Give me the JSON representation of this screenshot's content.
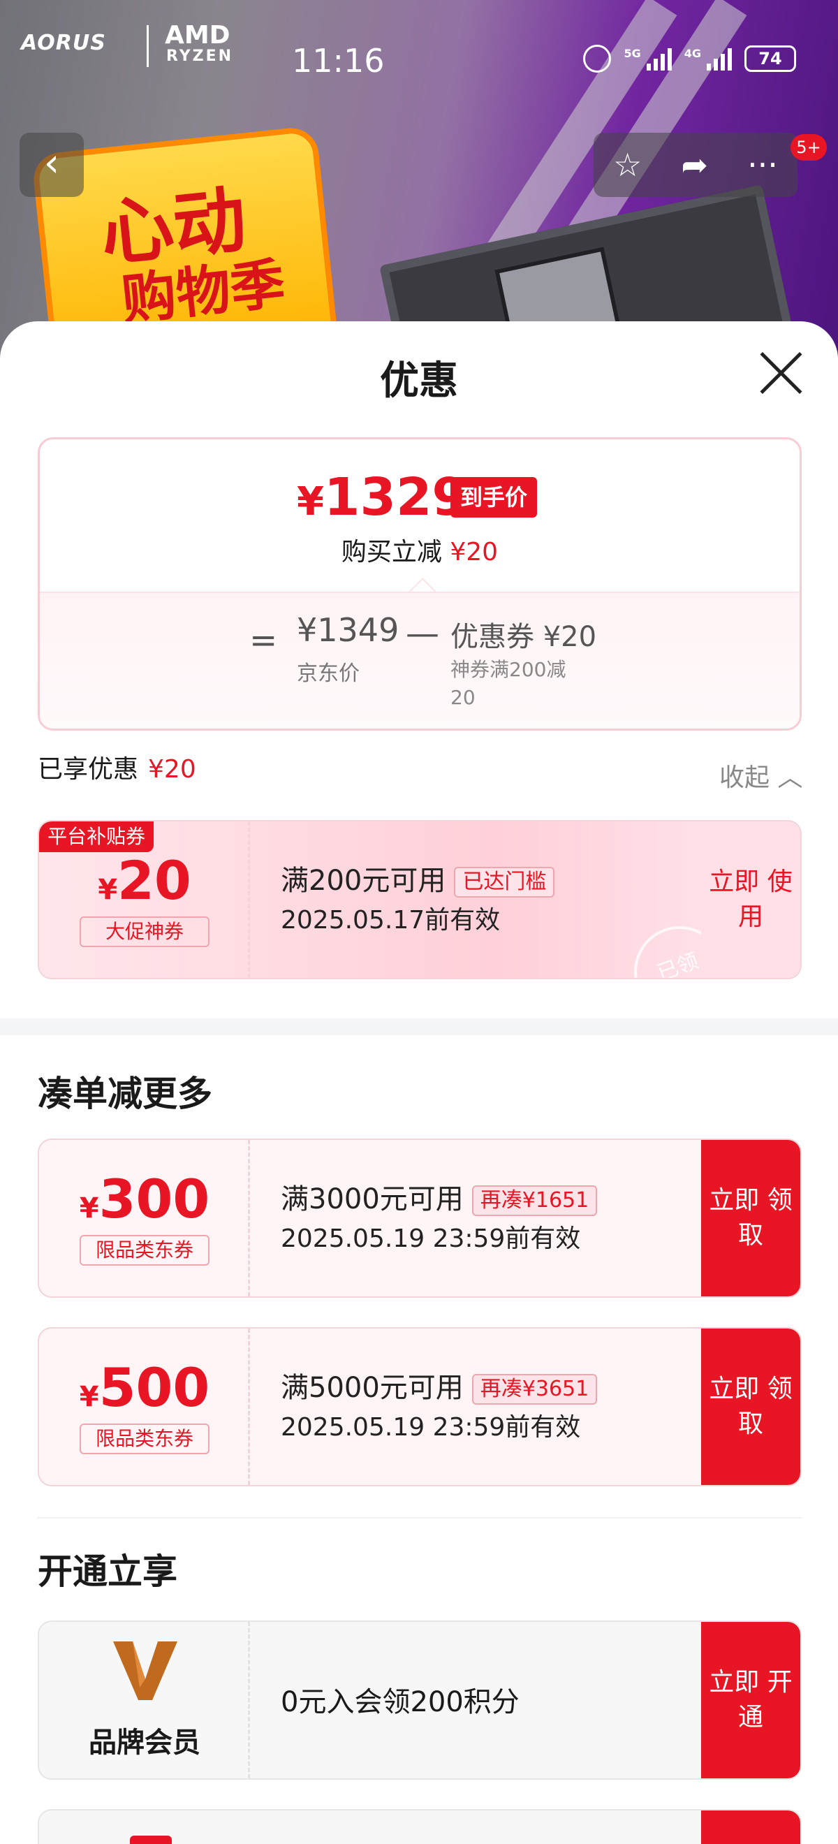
{
  "status_bar": {
    "brand_left": "AORUS",
    "brand_right_top": "AMD",
    "brand_right_bottom": "RYZEN",
    "time": "11:16",
    "network_1": "5G",
    "network_2": "4G",
    "battery": "74"
  },
  "banner": {
    "promo_line1": "心动",
    "promo_line2": "购物季",
    "notification_badge": "5+"
  },
  "sheet": {
    "title": "优惠",
    "price_summary": {
      "currency": "¥",
      "final_price": "1329",
      "final_label": "到手价",
      "reduce_prefix": "购买立减",
      "reduce_amount": "¥20",
      "equals": "=",
      "jd_price": "¥1349",
      "jd_price_label": "京东价",
      "minus": "—",
      "coupon_label": "优惠券 ¥20",
      "coupon_desc": "神券满200减20"
    },
    "enjoyed": {
      "label": "已享优惠",
      "amount": "¥20",
      "collapse_label": "收起 ︿"
    },
    "owned_coupon": {
      "ribbon": "平台补贴券",
      "currency": "¥",
      "amount": "20",
      "kind": "大促神券",
      "condition": "满200元可用",
      "tag": "已达门槛",
      "validity": "2025.05.17前有效",
      "action": "立即 使用",
      "stamp": "已领"
    },
    "section_more": "凑单减更多",
    "more_coupons": [
      {
        "currency": "¥",
        "amount": "300",
        "kind": "限品类东券",
        "condition": "满3000元可用",
        "tag": "再凑¥1651",
        "validity": "2025.05.19 23:59前有效",
        "action": "立即 领取"
      },
      {
        "currency": "¥",
        "amount": "500",
        "kind": "限品类东券",
        "condition": "满5000元可用",
        "tag": "再凑¥3651",
        "validity": "2025.05.19 23:59前有效",
        "action": "立即 领取"
      }
    ],
    "section_open": "开通立享",
    "member": {
      "name": "品牌会员",
      "desc": "0元入会领200积分",
      "action": "立即 开通"
    }
  },
  "colors": {
    "accent": "#e81624",
    "coupon_bg": "#fff5f6",
    "member_logo": "#c06a1f"
  }
}
